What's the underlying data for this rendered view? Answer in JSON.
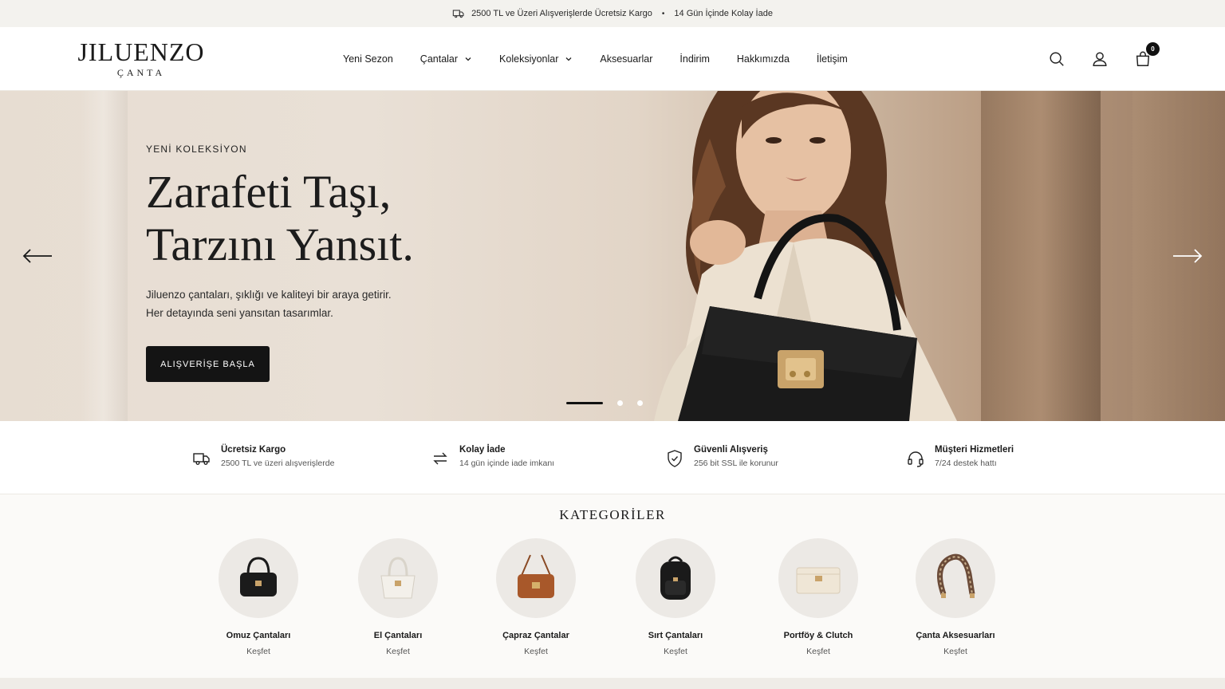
{
  "announcement": {
    "shipping": "2500 TL ve Üzeri Alışverişlerde Ücretsiz Kargo",
    "separator": "•",
    "returns": "14 Gün İçinde Kolay İade"
  },
  "header": {
    "brand": "JILUENZO",
    "brand_sub": "ÇANTA",
    "nav": [
      {
        "label": "Yeni Sezon"
      },
      {
        "label": "Çantalar",
        "dropdown": true
      },
      {
        "label": "Koleksiyonlar",
        "dropdown": true
      },
      {
        "label": "Aksesuarlar"
      },
      {
        "label": "İndirim"
      },
      {
        "label": "Hakkımızda"
      },
      {
        "label": "İletişim"
      }
    ],
    "icons": [
      "search-icon",
      "user-icon",
      "bag-icon"
    ],
    "cart_count": "0"
  },
  "hero": {
    "eyebrow": "YENİ KOLEKSİYON",
    "headline_line1": "Zarafeti Taşı,",
    "headline_line2": "Tarzını Yansıt.",
    "desc_line1": "Jiluenzo çantaları, şıklığı ve kaliteyi bir araya getirir.",
    "desc_line2": "Her detayında seni yansıtan tasarımlar.",
    "cta": "ALIŞVERİŞE BAŞLA",
    "slides": 3,
    "active_slide": 1
  },
  "features": [
    {
      "icon": "truck-icon",
      "title": "Ücretsiz Kargo",
      "text": "2500 TL ve üzeri alışverişlerde"
    },
    {
      "icon": "return-icon",
      "title": "Kolay İade",
      "text": "14 gün içinde iade imkanı"
    },
    {
      "icon": "shield-icon",
      "title": "Güvenli Alışveriş",
      "text": "256 bit SSL ile korunur"
    },
    {
      "icon": "headset-icon",
      "title": "Müşteri Hizmetleri",
      "text": "7/24 destek hattı"
    }
  ],
  "categories": {
    "title": "KATEGORİLER",
    "items": [
      {
        "name": "Omuz Çantaları",
        "link": "Keşfet",
        "color": "#1b1b1b"
      },
      {
        "name": "El Çantaları",
        "link": "Keşfet",
        "color": "#eeebe5"
      },
      {
        "name": "Çapraz Çantalar",
        "link": "Keşfet",
        "color": "#a8582a"
      },
      {
        "name": "Sırt Çantaları",
        "link": "Keşfet",
        "color": "#1a1a1a"
      },
      {
        "name": "Portföy & Clutch",
        "link": "Keşfet",
        "color": "#efe6d6"
      },
      {
        "name": "Çanta Aksesuarları",
        "link": "Keşfet",
        "color": "#6b4b38"
      }
    ]
  },
  "colors": {
    "accent": "#141414",
    "gold": "#c9a36a",
    "announce_bg": "#f3f2ee"
  }
}
